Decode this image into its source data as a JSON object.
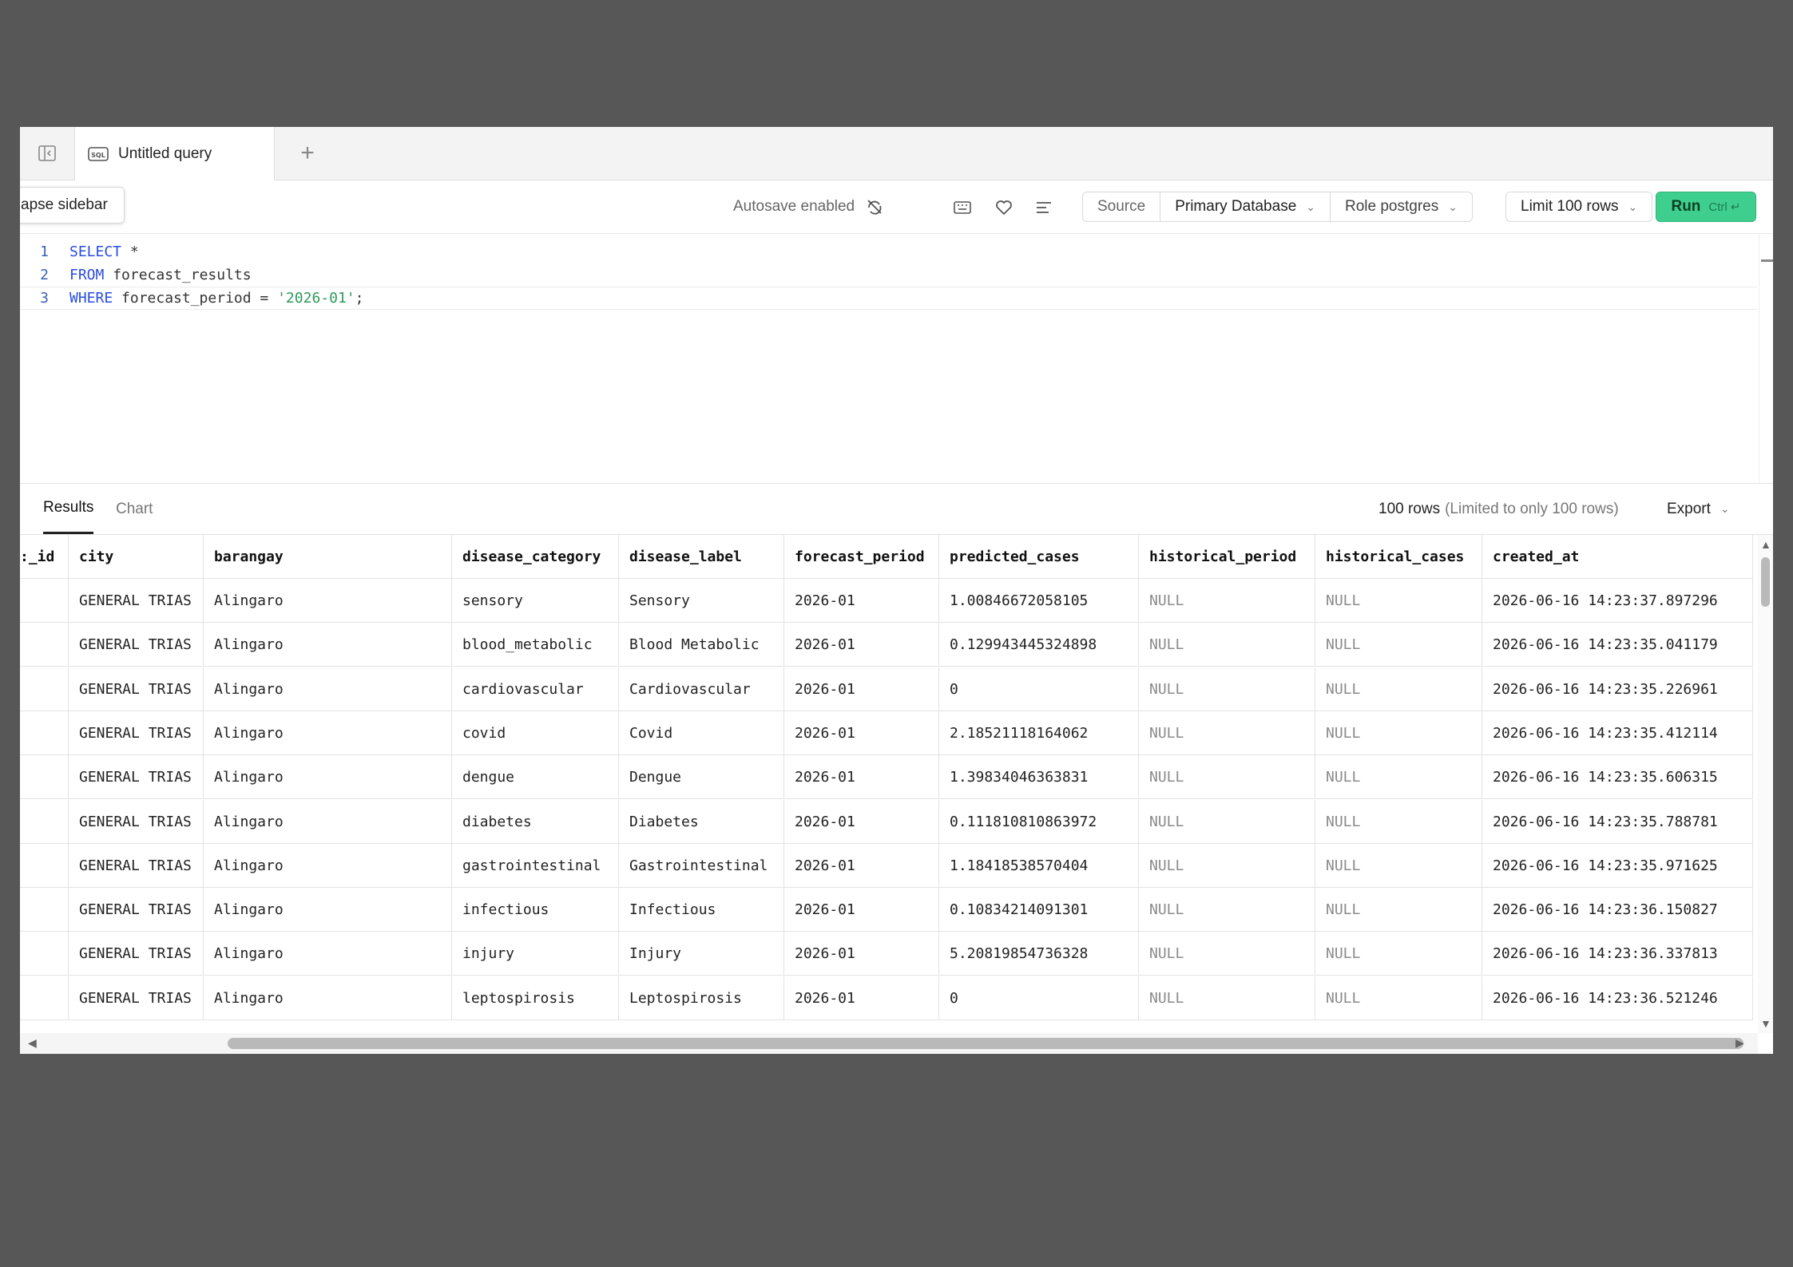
{
  "tabbar": {
    "tab_title": "Untitled query",
    "tab_icon": "sql-icon",
    "add_label": "+"
  },
  "toolbar": {
    "collapse_tooltip": "apse sidebar",
    "autosave": "Autosave enabled",
    "source_label": "Source",
    "database": "Primary Database",
    "role": "Role postgres",
    "limit": "Limit 100 rows",
    "run_label": "Run",
    "run_shortcut": "Ctrl ↵",
    "accent": "#3ecf8e"
  },
  "editor": {
    "lines": [
      {
        "num": "1",
        "kw": "SELECT",
        "rest": " *",
        "str": "",
        "end": ""
      },
      {
        "num": "2",
        "kw": "FROM",
        "rest": " forecast_results",
        "str": "",
        "end": ""
      },
      {
        "num": "3",
        "kw": "WHERE",
        "rest": " forecast_period = ",
        "str": "'2026-01'",
        "end": ";"
      }
    ]
  },
  "results": {
    "tab_results": "Results",
    "tab_chart": "Chart",
    "row_count": "100 rows",
    "limit_note": "(Limited to only 100 rows)",
    "export": "Export"
  },
  "grid": {
    "columns": [
      ":_id",
      "city",
      "barangay",
      "disease_category",
      "disease_label",
      "forecast_period",
      "predicted_cases",
      "historical_period",
      "historical_cases",
      "created_at"
    ],
    "rows": [
      [
        "",
        "GENERAL TRIAS",
        "Alingaro",
        "sensory",
        "Sensory",
        "2026-01",
        "1.00846672058105",
        "NULL",
        "NULL",
        "2026-06-16 14:23:37.897296"
      ],
      [
        "",
        "GENERAL TRIAS",
        "Alingaro",
        "blood_metabolic",
        "Blood Metabolic",
        "2026-01",
        "0.129943445324898",
        "NULL",
        "NULL",
        "2026-06-16 14:23:35.041179"
      ],
      [
        "",
        "GENERAL TRIAS",
        "Alingaro",
        "cardiovascular",
        "Cardiovascular",
        "2026-01",
        "0",
        "NULL",
        "NULL",
        "2026-06-16 14:23:35.226961"
      ],
      [
        "",
        "GENERAL TRIAS",
        "Alingaro",
        "covid",
        "Covid",
        "2026-01",
        "2.18521118164062",
        "NULL",
        "NULL",
        "2026-06-16 14:23:35.412114"
      ],
      [
        "",
        "GENERAL TRIAS",
        "Alingaro",
        "dengue",
        "Dengue",
        "2026-01",
        "1.39834046363831",
        "NULL",
        "NULL",
        "2026-06-16 14:23:35.606315"
      ],
      [
        "",
        "GENERAL TRIAS",
        "Alingaro",
        "diabetes",
        "Diabetes",
        "2026-01",
        "0.111810810863972",
        "NULL",
        "NULL",
        "2026-06-16 14:23:35.788781"
      ],
      [
        "",
        "GENERAL TRIAS",
        "Alingaro",
        "gastrointestinal",
        "Gastrointestinal",
        "2026-01",
        "1.18418538570404",
        "NULL",
        "NULL",
        "2026-06-16 14:23:35.971625"
      ],
      [
        "",
        "GENERAL TRIAS",
        "Alingaro",
        "infectious",
        "Infectious",
        "2026-01",
        "0.10834214091301",
        "NULL",
        "NULL",
        "2026-06-16 14:23:36.150827"
      ],
      [
        "",
        "GENERAL TRIAS",
        "Alingaro",
        "injury",
        "Injury",
        "2026-01",
        "5.20819854736328",
        "NULL",
        "NULL",
        "2026-06-16 14:23:36.337813"
      ],
      [
        "",
        "GENERAL TRIAS",
        "Alingaro",
        "leptospirosis",
        "Leptospirosis",
        "2026-01",
        "0",
        "NULL",
        "NULL",
        "2026-06-16 14:23:36.521246"
      ]
    ]
  }
}
